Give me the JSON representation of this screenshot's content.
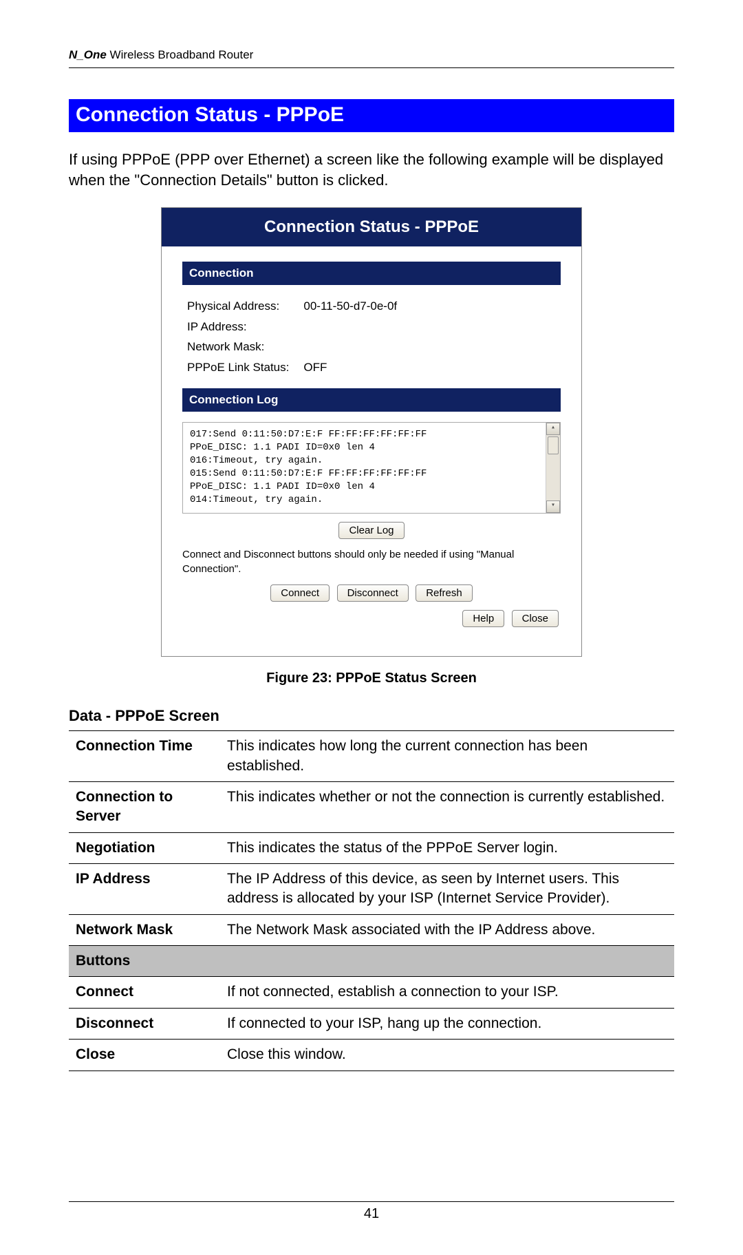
{
  "header": {
    "italic_prefix": "N_One",
    "rest": " Wireless Broadband Router"
  },
  "section_title": "Connection Status - PPPoE",
  "intro": "If using PPPoE (PPP over Ethernet) a screen like the following example will be displayed when the \"Connection Details\" button is clicked.",
  "screenshot": {
    "title": "Connection Status - PPPoE",
    "panel_connection": "Connection",
    "fields": {
      "physical_address_label": "Physical Address:",
      "physical_address_value": "00-11-50-d7-0e-0f",
      "ip_label": "IP Address:",
      "ip_value": "",
      "mask_label": "Network Mask:",
      "mask_value": "",
      "link_label": "PPPoE Link Status:",
      "link_value": "OFF"
    },
    "panel_log": "Connection Log",
    "log_lines": "017:Send 0:11:50:D7:E:F FF:FF:FF:FF:FF:FF\nPPoE_DISC: 1.1 PADI ID=0x0 len 4\n016:Timeout, try again.\n015:Send 0:11:50:D7:E:F FF:FF:FF:FF:FF:FF\nPPoE_DISC: 1.1 PADI ID=0x0 len 4\n014:Timeout, try again.",
    "clear_log_btn": "Clear Log",
    "note": "Connect and Disconnect buttons should only be needed if using \"Manual Connection\".",
    "connect_btn": "Connect",
    "disconnect_btn": "Disconnect",
    "refresh_btn": "Refresh",
    "help_btn": "Help",
    "close_btn": "Close"
  },
  "figure_caption": "Figure 23: PPPoE Status Screen",
  "data_heading": "Data - PPPoE Screen",
  "table": {
    "rows": [
      {
        "label": "Connection Time",
        "desc": "This indicates how long the current connection has been established."
      },
      {
        "label": "Connection to Server",
        "desc": "This indicates whether or not the connection is currently established."
      },
      {
        "label": "Negotiation",
        "desc": "This indicates the status of the PPPoE Server login."
      },
      {
        "label": "IP Address",
        "desc": "The IP Address of this device, as seen by Internet users. This address is allocated by your ISP (Internet Service Provider)."
      },
      {
        "label": "Network Mask",
        "desc": "The Network Mask associated with the IP Address above."
      }
    ],
    "buttons_header": "Buttons",
    "button_rows": [
      {
        "label": "Connect",
        "desc": "If not connected, establish a connection to your ISP."
      },
      {
        "label": "Disconnect",
        "desc": "If connected to your ISP, hang up the connection."
      },
      {
        "label": "Close",
        "desc": "Close this window."
      }
    ]
  },
  "page_number": "41"
}
